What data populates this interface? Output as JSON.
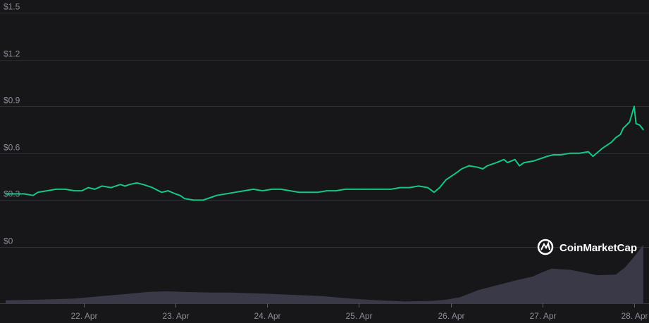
{
  "watermark": {
    "text": "CoinMarketCap",
    "icon": "coinmarketcap-logo-icon"
  },
  "colors": {
    "background": "#17171a",
    "price_line": "#16c784",
    "volume_fill": "#3a3947",
    "grid": "#2f3035",
    "tick_text": "#8a8d98"
  },
  "chart_data": {
    "type": "line",
    "title": "",
    "xlabel": "",
    "ylabel": "",
    "grid": true,
    "y_ticks": [
      "$1.5",
      "$1.2",
      "$0.9",
      "$0.6",
      "$0.3",
      "$0"
    ],
    "y_tick_values": [
      1.5,
      1.2,
      0.9,
      0.6,
      0.3,
      0
    ],
    "ylim": [
      0,
      1.5
    ],
    "x_ticks": [
      "22. Apr",
      "23. Apr",
      "24. Apr",
      "25. Apr",
      "26. Apr",
      "27. Apr",
      "28. Apr"
    ],
    "x_tick_values": [
      22,
      23,
      24,
      25,
      26,
      27,
      28
    ],
    "xlim": [
      21.15,
      28.1
    ],
    "series": [
      {
        "values_x": [
          21.15,
          21.25,
          21.35,
          21.45,
          21.5,
          21.6,
          21.7,
          21.8,
          21.9,
          21.98,
          22.05,
          22.12,
          22.2,
          22.3,
          22.4,
          22.45,
          22.5,
          22.58,
          22.65,
          22.75,
          22.85,
          22.92,
          23.0,
          23.05,
          23.1,
          23.2,
          23.3,
          23.4,
          23.45,
          23.55,
          23.65,
          23.75,
          23.85,
          23.95,
          24.05,
          24.15,
          24.25,
          24.35,
          24.45,
          24.55,
          24.65,
          24.75,
          24.85,
          24.95,
          25.05,
          25.15,
          25.25,
          25.35,
          25.45,
          25.55,
          25.65,
          25.75,
          25.82,
          25.88,
          25.95,
          26.0,
          26.05,
          26.12,
          26.2,
          26.3,
          26.35,
          26.4,
          26.5,
          26.58,
          26.62,
          26.7,
          26.75,
          26.8,
          26.9,
          27.0,
          27.05,
          27.12,
          27.2,
          27.3,
          27.4,
          27.5,
          27.55,
          27.65,
          27.75,
          27.8,
          27.85,
          27.88,
          27.95,
          28.0,
          28.02,
          28.06,
          28.1
        ],
        "values_y": [
          0.34,
          0.34,
          0.34,
          0.33,
          0.35,
          0.36,
          0.37,
          0.37,
          0.36,
          0.36,
          0.38,
          0.37,
          0.39,
          0.38,
          0.4,
          0.39,
          0.4,
          0.41,
          0.4,
          0.38,
          0.35,
          0.36,
          0.34,
          0.33,
          0.31,
          0.3,
          0.3,
          0.32,
          0.33,
          0.34,
          0.35,
          0.36,
          0.37,
          0.36,
          0.37,
          0.37,
          0.36,
          0.35,
          0.35,
          0.35,
          0.36,
          0.36,
          0.37,
          0.37,
          0.37,
          0.37,
          0.37,
          0.37,
          0.38,
          0.38,
          0.39,
          0.38,
          0.35,
          0.38,
          0.43,
          0.45,
          0.47,
          0.5,
          0.52,
          0.51,
          0.5,
          0.52,
          0.54,
          0.56,
          0.54,
          0.56,
          0.52,
          0.54,
          0.55,
          0.57,
          0.58,
          0.59,
          0.59,
          0.6,
          0.6,
          0.61,
          0.58,
          0.63,
          0.67,
          0.7,
          0.72,
          0.76,
          0.8,
          0.9,
          0.79,
          0.78,
          0.75
        ]
      }
    ],
    "volume_relative": {
      "x": [
        21.15,
        21.5,
        21.9,
        22.2,
        22.5,
        22.7,
        22.9,
        23.1,
        23.4,
        23.6,
        23.8,
        24.0,
        24.3,
        24.6,
        24.9,
        25.2,
        25.5,
        25.8,
        25.95,
        26.1,
        26.3,
        26.5,
        26.7,
        26.9,
        27.0,
        27.1,
        27.3,
        27.5,
        27.6,
        27.8,
        27.9,
        28.0,
        28.1
      ],
      "y": [
        0.05,
        0.06,
        0.08,
        0.12,
        0.16,
        0.19,
        0.2,
        0.19,
        0.18,
        0.18,
        0.17,
        0.16,
        0.14,
        0.12,
        0.08,
        0.05,
        0.03,
        0.04,
        0.06,
        0.1,
        0.22,
        0.3,
        0.38,
        0.45,
        0.52,
        0.58,
        0.56,
        0.5,
        0.47,
        0.48,
        0.6,
        0.78,
        0.98
      ]
    }
  }
}
